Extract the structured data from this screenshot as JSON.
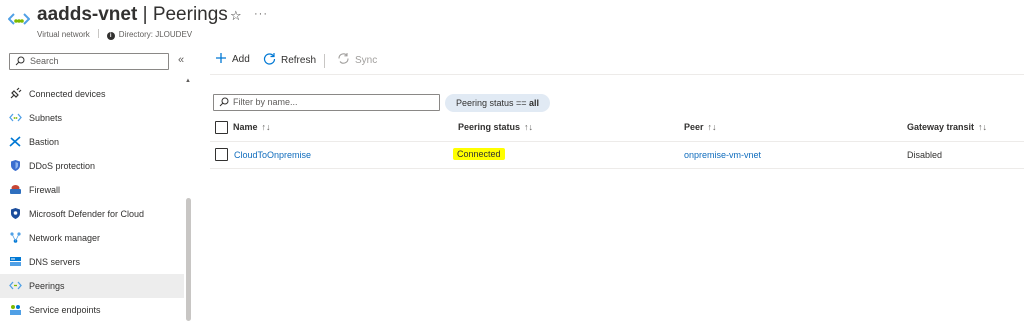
{
  "header": {
    "resource_name": "aadds-vnet",
    "separator": " | ",
    "blade_name": "Peerings",
    "resource_type": "Virtual network",
    "directory_label": "Directory: JLOUDEV",
    "favorite_icon": "star-icon",
    "more_icon": "ellipsis-icon"
  },
  "sidebar": {
    "search_placeholder": "Search",
    "collapse_icon": "chevron-double-left-icon",
    "items": [
      {
        "label": "Connected devices",
        "icon": "plug-icon"
      },
      {
        "label": "Subnets",
        "icon": "subnet-icon"
      },
      {
        "label": "Bastion",
        "icon": "bastion-icon"
      },
      {
        "label": "DDoS protection",
        "icon": "shield-icon"
      },
      {
        "label": "Firewall",
        "icon": "firewall-icon"
      },
      {
        "label": "Microsoft Defender for Cloud",
        "icon": "defender-shield-icon"
      },
      {
        "label": "Network manager",
        "icon": "network-manager-icon"
      },
      {
        "label": "DNS servers",
        "icon": "dns-server-icon"
      },
      {
        "label": "Peerings",
        "icon": "peering-icon",
        "active": true
      },
      {
        "label": "Service endpoints",
        "icon": "service-endpoint-icon"
      }
    ]
  },
  "toolbar": {
    "add_label": "Add",
    "refresh_label": "Refresh",
    "sync_label": "Sync"
  },
  "filters": {
    "name_placeholder": "Filter by name...",
    "pill_prefix": "Peering status == ",
    "pill_value": "all"
  },
  "table": {
    "columns": [
      {
        "label": "Name",
        "sort": "↑↓"
      },
      {
        "label": "Peering status",
        "sort": "↑↓"
      },
      {
        "label": "Peer",
        "sort": "↑↓"
      },
      {
        "label": "Gateway transit",
        "sort": "↑↓"
      }
    ],
    "rows": [
      {
        "name": "CloudToOnpremise",
        "status": "Connected",
        "peer": "onpremise-vm-vnet",
        "gateway_transit": "Disabled"
      }
    ]
  },
  "colors": {
    "link": "#0f6cbd",
    "highlight": "#ffff00",
    "pill_bg": "#e1eaf4",
    "active_nav_bg": "#ededed"
  }
}
